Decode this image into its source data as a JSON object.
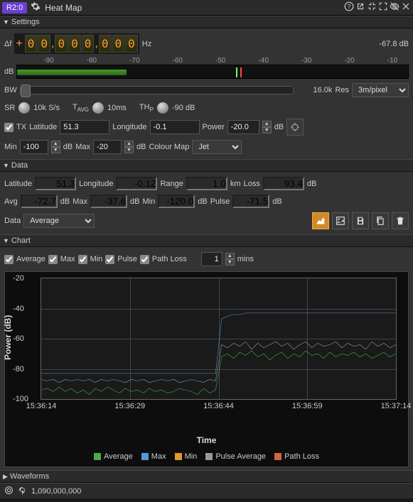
{
  "titlebar": {
    "tag": "R2:0",
    "title": "Heat Map"
  },
  "sections": {
    "settings": "Settings",
    "data": "Data",
    "chart": "Chart",
    "waveforms": "Waveforms"
  },
  "settings": {
    "df_label": "Δf",
    "df_sign": "+",
    "df_digits": [
      "0",
      "0",
      "0",
      "0",
      "0",
      "0",
      "0",
      "0"
    ],
    "hz": "Hz",
    "top_db": "-67.8  dB",
    "db_label": "dB",
    "ind_ticks": [
      "-90",
      "-80",
      "-70",
      "-60",
      "-50",
      "-40",
      "-30",
      "-20",
      "-10"
    ],
    "bw_label": "BW",
    "bw_value": "16.0k",
    "res_label": "Res",
    "res_value": "3m/pixel",
    "sr_label": "SR",
    "sr_value": "10k S/s",
    "tavg_label": "T",
    "tavg_sub": "AVG",
    "tavg_value": "10ms",
    "thp_label": "TH",
    "thp_sub": "P",
    "thp_value": "-90 dB",
    "tx_label": "TX",
    "lat_label": "Latitude",
    "lat_value": "51.3",
    "lon_label": "Longitude",
    "lon_value": "-0.1",
    "power_label": "Power",
    "power_value": "-20.0",
    "db_unit": "dB",
    "min_label": "Min",
    "min_value": "-100",
    "max_label": "Max",
    "max_value": "-20",
    "cmap_label": "Colour Map",
    "cmap_value": "Jet"
  },
  "data": {
    "lat_label": "Latitude",
    "lat_value": "51.3",
    "lon_label": "Longitude",
    "lon_value": "-0.12",
    "range_label": "Range",
    "range_value": "1.0",
    "km": "km",
    "loss_label": "Loss",
    "loss_value": "93.4",
    "db": "dB",
    "avg_label": "Avg",
    "avg_value": "-72.7",
    "max_label": "Max",
    "max_value": "-37.6",
    "min_label": "Min",
    "min_value": "-120.0",
    "pulse_label": "Pulse",
    "pulse_value": "-71.5",
    "data_label": "Data",
    "data_select": "Average"
  },
  "chart": {
    "cb_average": "Average",
    "cb_max": "Max",
    "cb_min": "Min",
    "cb_pulse": "Pulse",
    "cb_pathloss": "Path Loss",
    "mins_value": "1",
    "mins_label": "mins",
    "ylabel": "Power (dB)",
    "xlabel": "Time",
    "legend": {
      "average": "Average",
      "max": "Max",
      "min": "Min",
      "pulse": "Pulse Average",
      "pathloss": "Path Loss"
    },
    "colors": {
      "average": "#4aaa4a",
      "max": "#5599dd",
      "min": "#dd9933",
      "pulse": "#999999",
      "pathloss": "#cc6644"
    }
  },
  "chart_data": {
    "type": "line",
    "xlabel": "Time",
    "ylabel": "Power (dB)",
    "ylim": [
      -100,
      -20
    ],
    "x_ticks": [
      "15:36:14",
      "15:36:29",
      "15:36:44",
      "15:36:59",
      "15:37:14"
    ],
    "y_ticks": [
      -20,
      -40,
      -60,
      -80,
      -100
    ],
    "series": [
      {
        "name": "Average",
        "color": "#4aaa4a",
        "values": [
          -94,
          -93,
          -95,
          -92,
          -95,
          -93,
          -96,
          -94,
          -97,
          -93,
          -95,
          -92,
          -94,
          -96,
          -93,
          -95,
          -94,
          -96,
          -93,
          -95,
          -94,
          -96,
          -95,
          -93,
          -94,
          -95,
          -97,
          -93,
          -96,
          -94,
          -72,
          -70,
          -73,
          -69,
          -71,
          -68,
          -72,
          -70,
          -74,
          -71,
          -69,
          -73,
          -70,
          -72,
          -68,
          -71,
          -70,
          -73,
          -69,
          -72,
          -70,
          -71,
          -69,
          -72,
          -70,
          -73,
          -71,
          -69,
          -72,
          -70
        ]
      },
      {
        "name": "Max",
        "color": "#5599dd",
        "values": [
          -83,
          -83,
          -83,
          -83,
          -83,
          -83,
          -83,
          -83,
          -83,
          -83,
          -83,
          -83,
          -83,
          -83,
          -83,
          -83,
          -83,
          -83,
          -83,
          -83,
          -83,
          -83,
          -83,
          -83,
          -83,
          -83,
          -83,
          -83,
          -83,
          -83,
          -47,
          -45,
          -44,
          -44,
          -43,
          -43,
          -43,
          -43,
          -43,
          -43,
          -43,
          -43,
          -43,
          -43,
          -43,
          -43,
          -43,
          -43,
          -43,
          -43,
          -43,
          -43,
          -43,
          -43,
          -43,
          -43,
          -43,
          -43,
          -43,
          -43
        ]
      },
      {
        "name": "Pulse Average",
        "color": "#999999",
        "values": [
          -87,
          -88,
          -87,
          -89,
          -87,
          -88,
          -87,
          -88,
          -87,
          -89,
          -87,
          -88,
          -87,
          -88,
          -89,
          -87,
          -88,
          -87,
          -89,
          -88,
          -87,
          -88,
          -87,
          -89,
          -88,
          -87,
          -88,
          -89,
          -87,
          -88,
          -64,
          -66,
          -63,
          -65,
          -62,
          -67,
          -63,
          -66,
          -64,
          -62,
          -65,
          -63,
          -67,
          -64,
          -62,
          -66,
          -63,
          -65,
          -64,
          -62,
          -66,
          -63,
          -65,
          -64,
          -67,
          -62,
          -65,
          -63,
          -66,
          -64
        ]
      }
    ]
  },
  "status": {
    "freq": "1,090,000,000"
  }
}
